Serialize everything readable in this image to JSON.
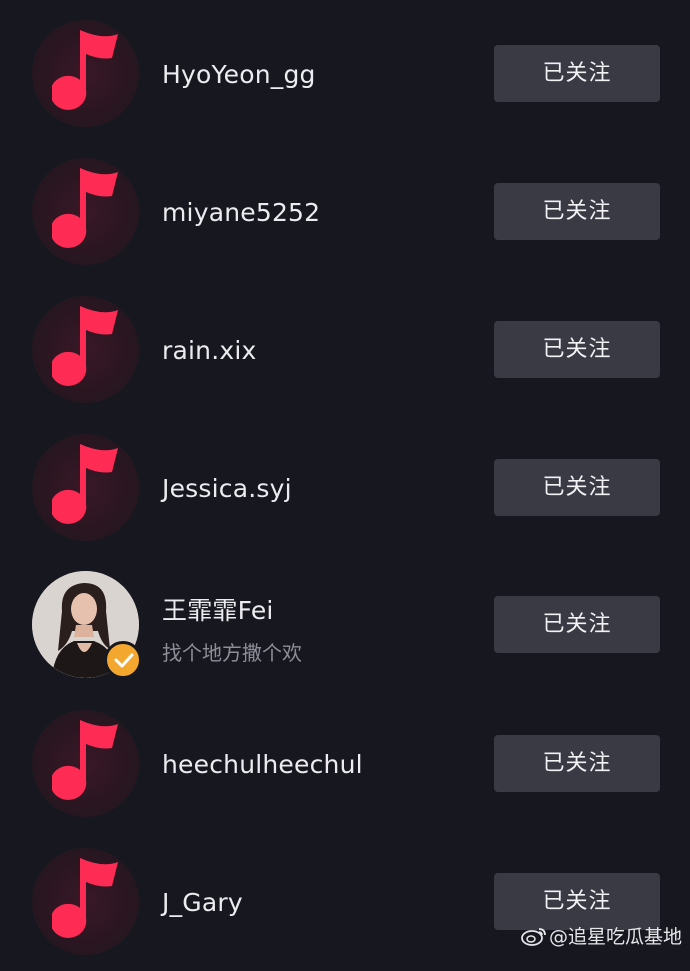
{
  "following_list": {
    "items": [
      {
        "name": "HyoYeon_gg",
        "avatar": "music-note-default-avatar",
        "button_label": "已关注"
      },
      {
        "name": "miyane5252",
        "avatar": "music-note-default-avatar",
        "button_label": "已关注"
      },
      {
        "name": "rain.xix",
        "avatar": "music-note-default-avatar",
        "button_label": "已关注"
      },
      {
        "name": "Jessica.syj",
        "avatar": "music-note-default-avatar",
        "button_label": "已关注"
      },
      {
        "name": "王霏霏Fei",
        "bio": "找个地方撒个欢",
        "avatar": "user-photo-avatar",
        "verified_icon": "verified-check-icon",
        "button_label": "已关注"
      },
      {
        "name": "heechulheechul",
        "avatar": "music-note-default-avatar",
        "button_label": "已关注"
      },
      {
        "name": "J_Gary",
        "avatar": "music-note-default-avatar",
        "button_label": "已关注"
      }
    ]
  },
  "watermark": {
    "icon": "weibo-logo-icon",
    "text": "@追星吃瓜基地"
  },
  "colors": {
    "background": "#17181f",
    "button_bg": "#393a44",
    "note_pink": "#fe2c55",
    "verified_orange": "#f4a72e"
  }
}
